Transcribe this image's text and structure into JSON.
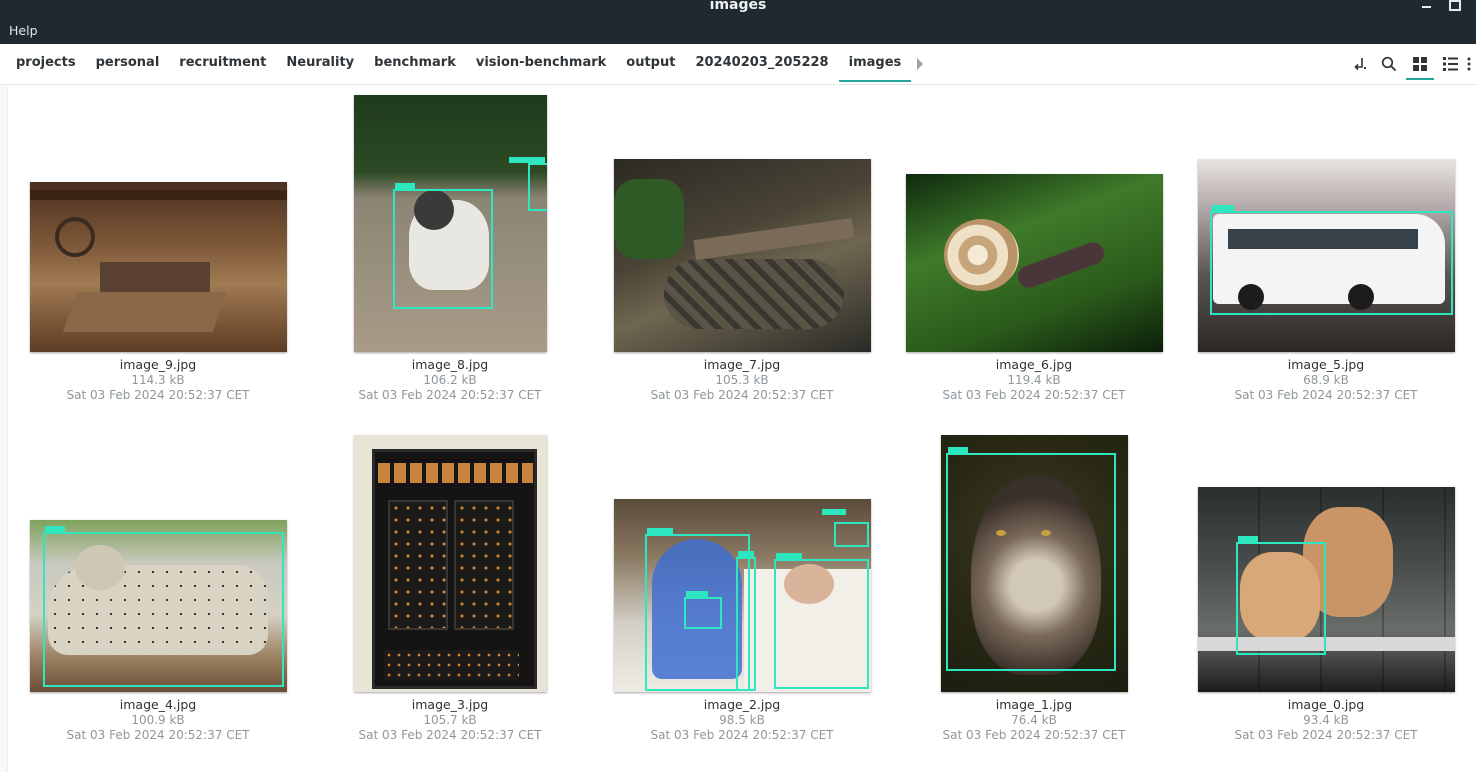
{
  "window": {
    "title": "images",
    "menu_help": "Help"
  },
  "breadcrumb": [
    "projects",
    "personal",
    "recruitment",
    "Neurality",
    "benchmark",
    "vision-benchmark",
    "output",
    "20240203_205228",
    "images"
  ],
  "toolbar_icons": [
    "open-terminal-icon",
    "search-icon",
    "grid-view-icon",
    "list-view-icon",
    "more-icon"
  ],
  "files": [
    {
      "name": "image_9.jpg",
      "size": "114.3 kB",
      "date": "Sat 03 Feb 2024 20:52:37 CET",
      "subject": "barn interior with machinery"
    },
    {
      "name": "image_8.jpg",
      "size": "106.2 kB",
      "date": "Sat 03 Feb 2024 20:52:37 CET",
      "subject": "husky dog with detection box"
    },
    {
      "name": "image_7.jpg",
      "size": "105.3 kB",
      "date": "Sat 03 Feb 2024 20:52:37 CET",
      "subject": "rattlesnake among leaves"
    },
    {
      "name": "image_6.jpg",
      "size": "119.4 kB",
      "date": "Sat 03 Feb 2024 20:52:37 CET",
      "subject": "snail on grass"
    },
    {
      "name": "image_5.jpg",
      "size": "68.9 kB",
      "date": "Sat 03 Feb 2024 20:52:37 CET",
      "subject": "white bus with detection box"
    },
    {
      "name": "image_4.jpg",
      "size": "100.9 kB",
      "date": "Sat 03 Feb 2024 20:52:37 CET",
      "subject": "snow leopard with detection box"
    },
    {
      "name": "image_3.jpg",
      "size": "105.7 kB",
      "date": "Sat 03 Feb 2024 20:52:37 CET",
      "subject": "black wooden wardrobe"
    },
    {
      "name": "image_2.jpg",
      "size": "98.5 kB",
      "date": "Sat 03 Feb 2024 20:52:37 CET",
      "subject": "baby crib and person with detection boxes"
    },
    {
      "name": "image_1.jpg",
      "size": "76.4 kB",
      "date": "Sat 03 Feb 2024 20:52:37 CET",
      "subject": "wolf portrait with detection box"
    },
    {
      "name": "image_0.jpg",
      "size": "93.4 kB",
      "date": "Sat 03 Feb 2024 20:52:37 CET",
      "subject": "corgi dogs with detection box"
    }
  ],
  "colors": {
    "titlebar": "#1f2a30",
    "accent": "#26a69a",
    "detection_box": "#2ee6c0"
  }
}
